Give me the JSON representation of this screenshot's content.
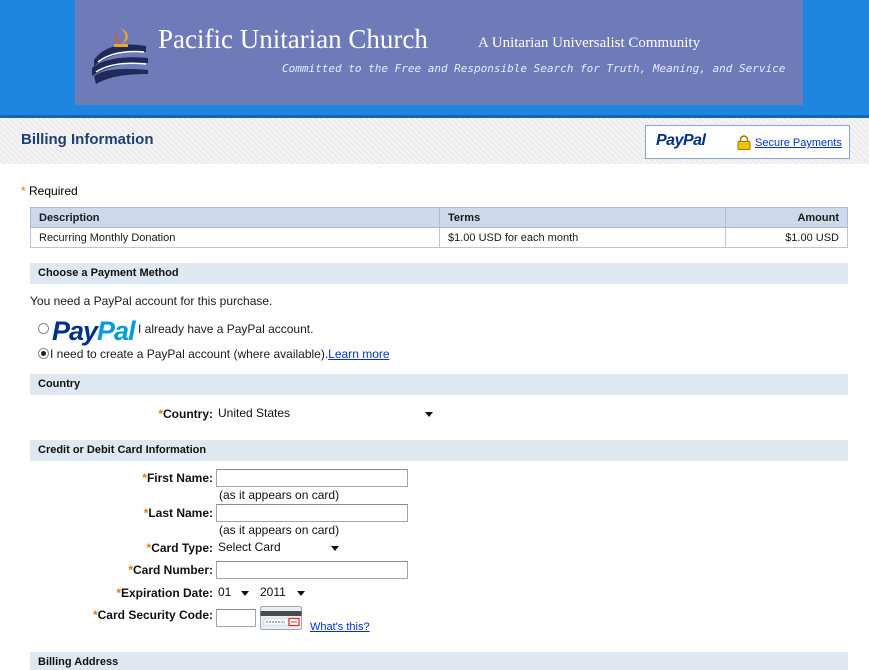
{
  "header": {
    "church_name": "Pacific Unitarian Church",
    "tagline": "A Unitarian Universalist Community",
    "motto": "Committed to the Free and Responsible Search for Truth, Meaning, and Service"
  },
  "billing": {
    "title": "Billing Information",
    "paypal_logo": "PayPal",
    "secure_link": "Secure Payments",
    "required_label": "Required"
  },
  "table": {
    "headers": [
      "Description",
      "Terms",
      "Amount"
    ],
    "rows": [
      [
        "Recurring Monthly Donation",
        "$1.00 USD for each month",
        "$1.00 USD"
      ]
    ]
  },
  "payment_method": {
    "section_title": "Choose a Payment Method",
    "notice": "You need a PayPal account for this purchase.",
    "option1_logo_a": "Pay",
    "option1_logo_b": "Pal",
    "option1_text": "I already have a PayPal account.",
    "option2_text": "I need to create a PayPal account (where available).",
    "learn_more": "Learn more",
    "selected": "option2"
  },
  "country": {
    "section_title": "Country",
    "label": "Country:",
    "value": "United States"
  },
  "card": {
    "section_title": "Credit or Debit Card Information",
    "first_name_label": "First Name:",
    "first_name_hint": "(as it appears on card)",
    "last_name_label": "Last Name:",
    "last_name_hint": "(as it appears on card)",
    "card_type_label": "Card Type:",
    "card_type_value": "Select Card",
    "card_number_label": "Card Number:",
    "expiration_label": "Expiration Date:",
    "exp_month": "01",
    "exp_year": "2011",
    "security_code_label": "Card Security Code:",
    "whats_this": "What's this?"
  },
  "billing_address": {
    "section_title": "Billing Address"
  },
  "colors": {
    "header_blue": "#1f86e0",
    "banner_purple": "#6f7ab9",
    "section_bg": "#dfe7f1",
    "required_star": "#e87a0a",
    "link_blue": "#0033cc",
    "paypal_navy": "#003087"
  }
}
